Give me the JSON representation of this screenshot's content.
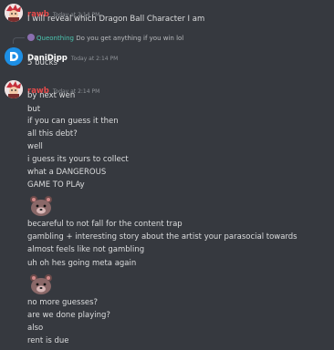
{
  "messages": [
    {
      "author": "rawb",
      "timestamp": "Today at 2:14 PM",
      "lines": [
        "I will reveal which Dragon Ball Character I am"
      ]
    },
    {
      "author": "DaniDipp",
      "timestamp": "Today at 2:14 PM",
      "reply": {
        "author": "Queonthing",
        "text": "Do you get anything if you win lol"
      },
      "lines": [
        "5 bucks"
      ]
    },
    {
      "author": "rawb",
      "timestamp": "Today at 2:14 PM",
      "lines": [
        "by next wen",
        "but",
        "if you can guess it then",
        "all this debt?",
        "well",
        "i guess its yours to collect",
        "what a DANGEROUS",
        "GAME TO PLAy",
        "becareful to not fall for the content trap",
        "gambling + interesting story about the artist your parasocial towards",
        "almost feels like not gambling",
        "uh oh hes going meta again",
        "no more guesses?",
        "are we done playing?",
        "also",
        "rent is due"
      ]
    }
  ],
  "colors": {
    "background": "#36393f",
    "text": "#dcddde",
    "rawb": "#e64b4b",
    "reply_name": "#4bc6b0",
    "timestamp": "#8e9297",
    "dani_avatar": "#1d8fe5"
  },
  "icons": {
    "rawb_avatar": "anime-character-avatar",
    "dani_avatar": "letter-d-logo-avatar",
    "sticker": "bear-emote"
  }
}
